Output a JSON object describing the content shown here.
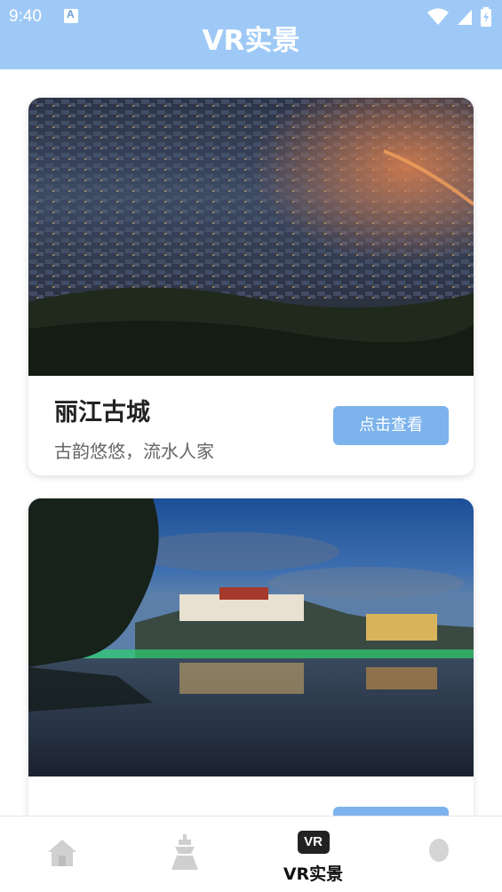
{
  "status_bar": {
    "time": "9:40",
    "app_icon": "a-badge-icon",
    "icons": [
      "wifi-icon",
      "signal-icon",
      "battery-icon"
    ]
  },
  "header": {
    "title": "VR实景",
    "background": "#9ec9f6"
  },
  "cards": [
    {
      "name": "丽江古城",
      "description": "古韵悠悠，流水人家",
      "button_label": "点击查看",
      "image": "lijiang-old-town-night-aerial"
    },
    {
      "name": "",
      "description": "",
      "button_label": "",
      "image": "potala-palace-night-reflection"
    }
  ],
  "bottom_nav": {
    "items": [
      {
        "icon": "home-icon",
        "label": ""
      },
      {
        "icon": "tower-icon",
        "label": ""
      },
      {
        "icon": "vr-icon",
        "badge": "VR",
        "label": "VR实景",
        "active": true
      },
      {
        "icon": "profile-icon",
        "label": ""
      }
    ]
  },
  "colors": {
    "accent": "#7cb3ec",
    "header": "#9ec9f6",
    "text_primary": "#222222",
    "text_secondary": "#666666"
  }
}
